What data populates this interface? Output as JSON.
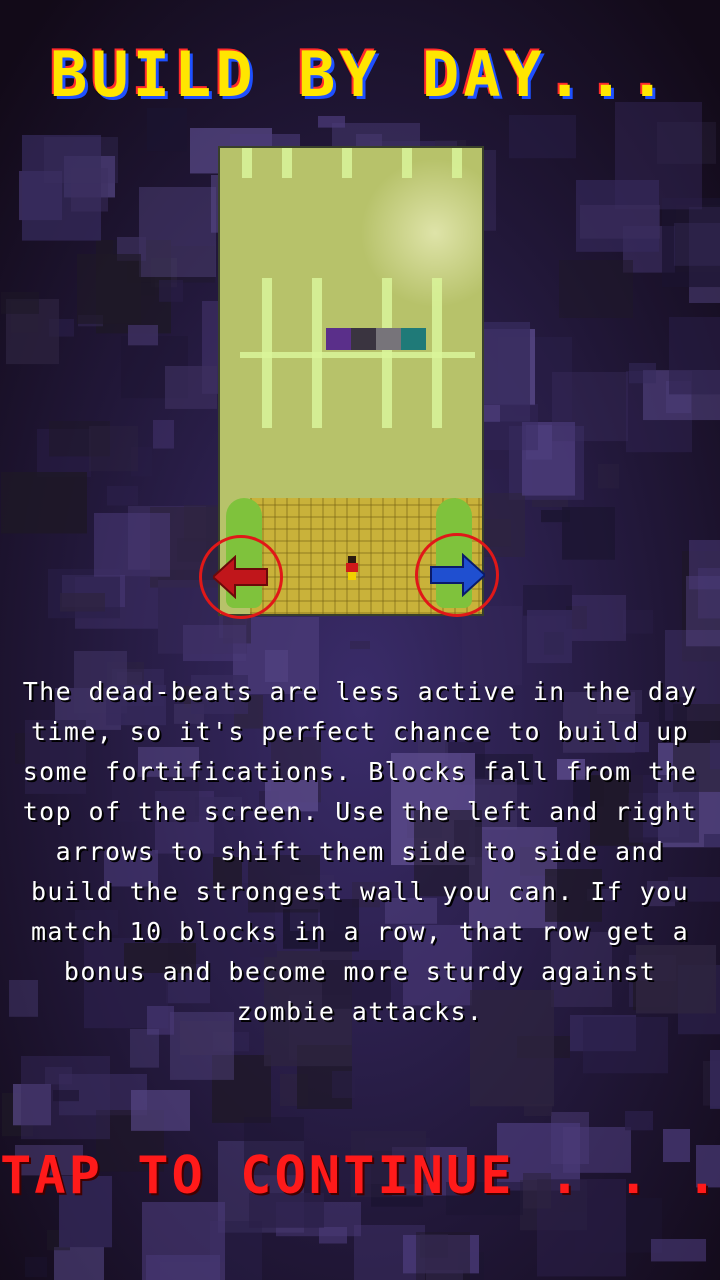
{
  "title": "BUILD BY DAY...",
  "description": "The dead-beats are less active in the day time, so it's perfect chance to build up some fortifications. Blocks fall from the top of the screen. Use the left and right arrows to shift them side to side and build the strongest wall you can. If you match 10 blocks in a row, that row get a bonus and become more sturdy against zombie attacks.",
  "tap_prompt": "TAP TO CONTINUE . . .",
  "colors": {
    "title": "#ffe600",
    "title_shadow_blue": "#1e50ff",
    "title_shadow_red": "#ff2a2a",
    "tap": "#ff1a1a",
    "left_arrow": "#c0161b",
    "right_arrow": "#1f4fd0",
    "button_ring": "#e01818"
  },
  "icons": {
    "left": "left-arrow-icon",
    "right": "right-arrow-icon"
  }
}
